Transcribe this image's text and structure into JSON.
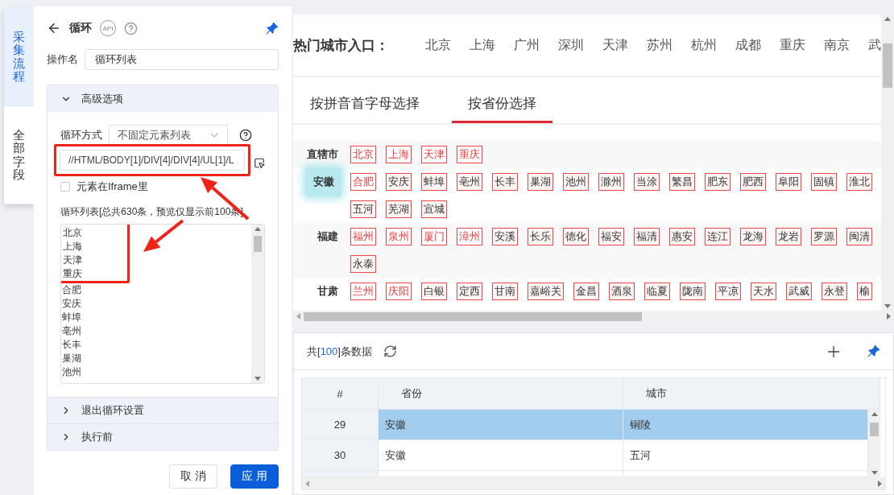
{
  "side_tabs": [
    {
      "label": "采集流程",
      "selected": true
    },
    {
      "label": "全部字段",
      "selected": false
    }
  ],
  "panel": {
    "title": "循环",
    "api_badge": "API",
    "pinned": true,
    "operation_name": {
      "label": "操作名",
      "value": "循环列表"
    },
    "advanced": {
      "title": "高级选项",
      "expanded": true,
      "loop_mode": {
        "label": "循环方式",
        "value": "不固定元素列表"
      },
      "xpath": {
        "value": "//HTML/BODY[1]/DIV[4]/DIV[4]/UL[1]/L",
        "highlighted": true
      },
      "iframe_checkbox": {
        "label": "元素在Iframe里",
        "checked": false
      },
      "loop_list": {
        "caption": "循环列表[总共630条，预览仅显示前100条]",
        "items": [
          {
            "text": "北京",
            "highlighted": true
          },
          {
            "text": "上海",
            "highlighted": true
          },
          {
            "text": "天津",
            "highlighted": true
          },
          {
            "text": "重庆",
            "highlighted": true
          },
          {
            "text": "合肥",
            "highlighted": false
          },
          {
            "text": "安庆",
            "highlighted": false
          },
          {
            "text": "蚌埠",
            "highlighted": false
          },
          {
            "text": "亳州",
            "highlighted": false
          },
          {
            "text": "长丰",
            "highlighted": false
          },
          {
            "text": "巢湖",
            "highlighted": false
          },
          {
            "text": "池州",
            "highlighted": false
          }
        ]
      },
      "arrows_shown": true
    },
    "collapsed_sections": [
      {
        "title": "退出循环设置",
        "expanded": false
      },
      {
        "title": "执行前",
        "expanded": false
      }
    ],
    "buttons": [
      {
        "label": "取 消",
        "kind": "secondary"
      },
      {
        "label": "应 用",
        "kind": "primary"
      }
    ]
  },
  "browser": {
    "hot_cities": {
      "label": "热门城市入口：",
      "cities": [
        "北京",
        "上海",
        "广州",
        "深圳",
        "天津",
        "苏州",
        "杭州",
        "成都",
        "重庆",
        "南京",
        "武"
      ]
    },
    "tabs": [
      {
        "label": "按拼音首字母选择",
        "selected": false
      },
      {
        "label": "按省份选择",
        "selected": true
      }
    ],
    "provinces": [
      {
        "name": "直辖市",
        "hovered": false,
        "cities": [
          {
            "name": "北京",
            "highlighted": true
          },
          {
            "name": "上海",
            "highlighted": true
          },
          {
            "name": "天津",
            "highlighted": true
          },
          {
            "name": "重庆",
            "highlighted": true
          }
        ]
      },
      {
        "name": "安徽",
        "hovered": true,
        "cities": [
          {
            "name": "合肥",
            "highlighted": true
          },
          {
            "name": "安庆",
            "highlighted": false
          },
          {
            "name": "蚌埠",
            "highlighted": false
          },
          {
            "name": "亳州",
            "highlighted": false
          },
          {
            "name": "长丰",
            "highlighted": false
          },
          {
            "name": "巢湖",
            "highlighted": false
          },
          {
            "name": "池州",
            "highlighted": false
          },
          {
            "name": "滁州",
            "highlighted": false
          },
          {
            "name": "当涂",
            "highlighted": false
          },
          {
            "name": "繁昌",
            "highlighted": false
          },
          {
            "name": "肥东",
            "highlighted": false
          },
          {
            "name": "肥西",
            "highlighted": false
          },
          {
            "name": "阜阳",
            "highlighted": false
          },
          {
            "name": "固镇",
            "highlighted": false
          },
          {
            "name": "淮北",
            "highlighted": false
          },
          {
            "name": "五河",
            "highlighted": false
          },
          {
            "name": "芜湖",
            "highlighted": false
          },
          {
            "name": "宣城",
            "highlighted": false
          }
        ]
      },
      {
        "name": "福建",
        "hovered": false,
        "cities": [
          {
            "name": "福州",
            "highlighted": true
          },
          {
            "name": "泉州",
            "highlighted": true
          },
          {
            "name": "厦门",
            "highlighted": true
          },
          {
            "name": "漳州",
            "highlighted": true
          },
          {
            "name": "安溪",
            "highlighted": false
          },
          {
            "name": "长乐",
            "highlighted": false
          },
          {
            "name": "德化",
            "highlighted": false
          },
          {
            "name": "福安",
            "highlighted": false
          },
          {
            "name": "福清",
            "highlighted": false
          },
          {
            "name": "惠安",
            "highlighted": false
          },
          {
            "name": "连江",
            "highlighted": false
          },
          {
            "name": "龙海",
            "highlighted": false
          },
          {
            "name": "龙岩",
            "highlighted": false
          },
          {
            "name": "罗源",
            "highlighted": false
          },
          {
            "name": "闽清",
            "highlighted": false
          },
          {
            "name": "永泰",
            "highlighted": false
          }
        ]
      },
      {
        "name": "甘肃",
        "hovered": false,
        "cities": [
          {
            "name": "兰州",
            "highlighted": true
          },
          {
            "name": "庆阳",
            "highlighted": true
          },
          {
            "name": "白银",
            "highlighted": false
          },
          {
            "name": "定西",
            "highlighted": false
          },
          {
            "name": "甘南",
            "highlighted": false
          },
          {
            "name": "嘉峪关",
            "highlighted": false
          },
          {
            "name": "金昌",
            "highlighted": false
          },
          {
            "name": "酒泉",
            "highlighted": false
          },
          {
            "name": "临夏",
            "highlighted": false
          },
          {
            "name": "陇南",
            "highlighted": false
          },
          {
            "name": "平凉",
            "highlighted": false
          },
          {
            "name": "天水",
            "highlighted": false
          },
          {
            "name": "武威",
            "highlighted": false
          },
          {
            "name": "永登",
            "highlighted": false
          },
          {
            "name": "榆",
            "highlighted": false
          }
        ]
      }
    ]
  },
  "data_panel": {
    "count_prefix": "共[",
    "count": "100",
    "count_suffix": "]条数据",
    "pinned": true,
    "columns": [
      "#",
      "省份",
      "城市"
    ],
    "rows": [
      {
        "index": "29",
        "province": "安徽",
        "city": "铜陵",
        "selected": true
      },
      {
        "index": "30",
        "province": "安徽",
        "city": "五河",
        "selected": false
      }
    ]
  }
}
